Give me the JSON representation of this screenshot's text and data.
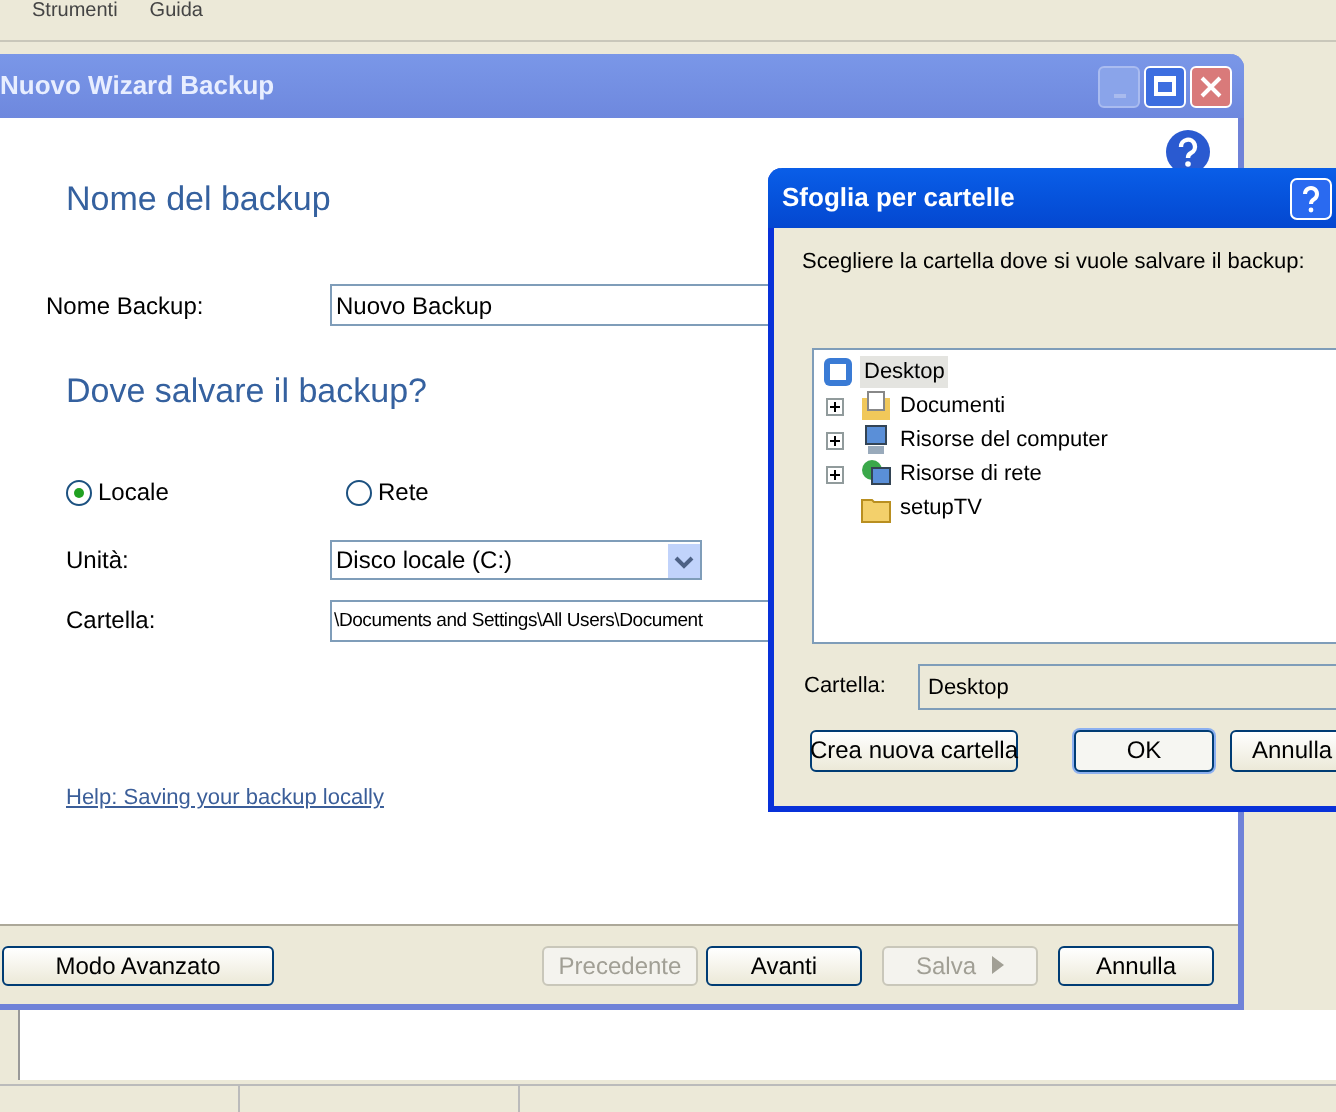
{
  "app_menu": [
    "Strumenti",
    "Guida"
  ],
  "wizard": {
    "title": "Nuovo Wizard Backup",
    "section_name": "Nome del backup",
    "name_label": "Nome Backup:",
    "name_value": "Nuovo Backup",
    "section_where": "Dove salvare il backup?",
    "location_options": [
      {
        "label": "Locale",
        "selected": true
      },
      {
        "label": "Rete",
        "selected": false
      }
    ],
    "drive_label": "Unità:",
    "drive_value": "Disco locale (C:)",
    "folder_label": "Cartella:",
    "folder_value": "\\Documents and Settings\\All Users\\Document",
    "help_link": "Help: Saving your backup locally",
    "buttons": [
      {
        "label": "Modo Avanzato",
        "disabled": false
      },
      {
        "label": "Precedente",
        "disabled": true
      },
      {
        "label": "Avanti",
        "disabled": false
      },
      {
        "label": "Salva",
        "disabled": true
      },
      {
        "label": "Annulla",
        "disabled": false
      }
    ]
  },
  "browse_dialog": {
    "title": "Sfoglia per cartelle",
    "prompt": "Scegliere la cartella dove si vuole salvare il backup:",
    "tree": [
      {
        "label": "Desktop",
        "kind": "desktop",
        "selected": true,
        "children": [
          {
            "label": "Documenti",
            "kind": "documents",
            "expandable": true,
            "selected": false
          },
          {
            "label": "Risorse del computer",
            "kind": "computer",
            "expandable": true,
            "selected": false
          },
          {
            "label": "Risorse di rete",
            "kind": "network",
            "expandable": true,
            "selected": false
          },
          {
            "label": "setupTV",
            "kind": "folder",
            "expandable": false,
            "selected": false
          }
        ]
      }
    ],
    "folder_label": "Cartella:",
    "folder_value": "Desktop",
    "buttons": [
      {
        "label": "Crea nuova cartella",
        "default": false
      },
      {
        "label": "OK",
        "default": true
      },
      {
        "label": "Annulla",
        "default": false
      }
    ]
  }
}
